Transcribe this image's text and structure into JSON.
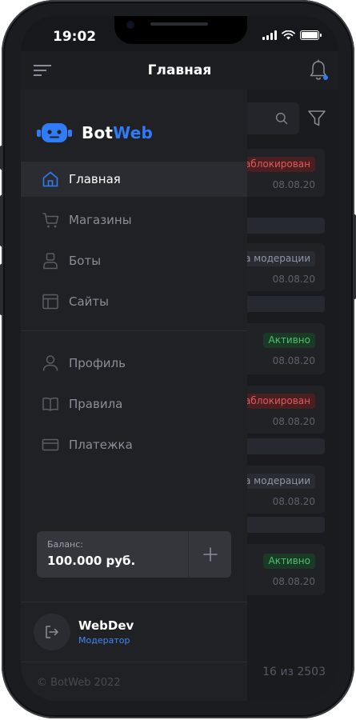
{
  "status_bar": {
    "time": "19:02"
  },
  "header": {
    "title": "Главная"
  },
  "brand": {
    "name_main": "Bot",
    "name_accent": "Web",
    "accent_color": "#2f7cf6"
  },
  "nav": {
    "primary": [
      {
        "label": "Главная",
        "icon": "home-icon",
        "active": true
      },
      {
        "label": "Магазины",
        "icon": "cart-icon"
      },
      {
        "label": "Боты",
        "icon": "bot-icon"
      },
      {
        "label": "Сайты",
        "icon": "layout-icon"
      }
    ],
    "secondary": [
      {
        "label": "Профиль",
        "icon": "user-icon"
      },
      {
        "label": "Правила",
        "icon": "book-icon"
      },
      {
        "label": "Платежка",
        "icon": "card-icon"
      }
    ]
  },
  "balance": {
    "label": "Баланс:",
    "value": "100.000 руб."
  },
  "user": {
    "name": "WebDev",
    "role": "Модератор"
  },
  "footer": {
    "copyright": "© BotWeb 2022"
  },
  "list": {
    "items": [
      {
        "status": "Заблокирован",
        "status_type": "blocked",
        "date": "08.08.20"
      },
      {
        "status": "На модерации",
        "status_type": "moder",
        "date": "08.08.20"
      },
      {
        "status": "Активно",
        "status_type": "active",
        "date": "08.08.20"
      },
      {
        "status": "Заблокирован",
        "status_type": "blocked",
        "date": "08.08.20"
      },
      {
        "status": "На модерации",
        "status_type": "moder",
        "date": "08.08.20"
      },
      {
        "status": "Активно",
        "status_type": "active",
        "date": "08.08.20"
      }
    ],
    "pagination": "16 из 2503"
  }
}
